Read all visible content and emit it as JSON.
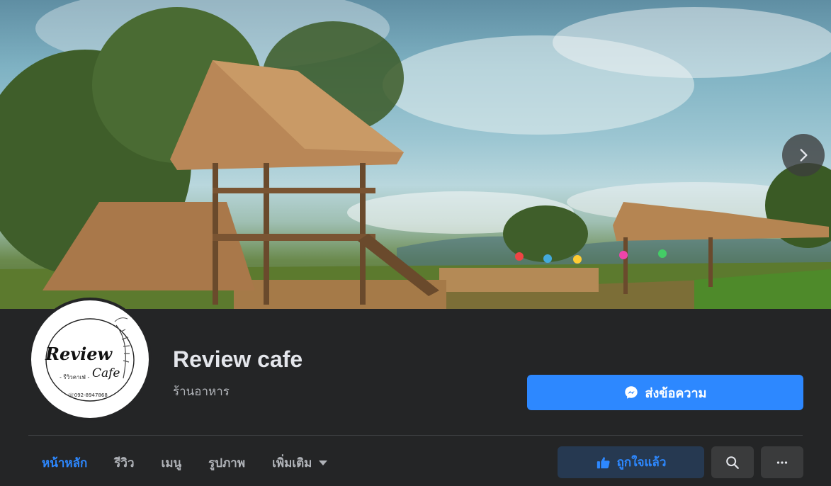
{
  "page": {
    "name": "Review cafe",
    "category": "ร้านอาหาร"
  },
  "logo": {
    "brand_text": "Review Cafe",
    "sub_text": "- รีวิวคาเฟ่ -",
    "phone": "092-8947868"
  },
  "actions": {
    "send_message_label": "ส่งข้อความ",
    "liked_label": "ถูกใจแล้ว"
  },
  "tabs": [
    {
      "label": "หน้าหลัก",
      "active": true
    },
    {
      "label": "รีวิว",
      "active": false
    },
    {
      "label": "เมนู",
      "active": false
    },
    {
      "label": "รูปภาพ",
      "active": false
    },
    {
      "label": "เพิ่มเติม",
      "active": false
    }
  ],
  "icons": {
    "next": "chevron-right-icon",
    "messenger": "messenger-icon",
    "like": "thumbs-up-icon",
    "search": "search-icon",
    "more": "more-horizontal-icon",
    "dropdown": "caret-down-icon"
  },
  "colors": {
    "background": "#242526",
    "accent": "#2d88ff",
    "like_bg": "#263951",
    "secondary_btn": "#3a3b3c",
    "text_primary": "#e4e6eb",
    "text_secondary": "#b0b3b8"
  }
}
